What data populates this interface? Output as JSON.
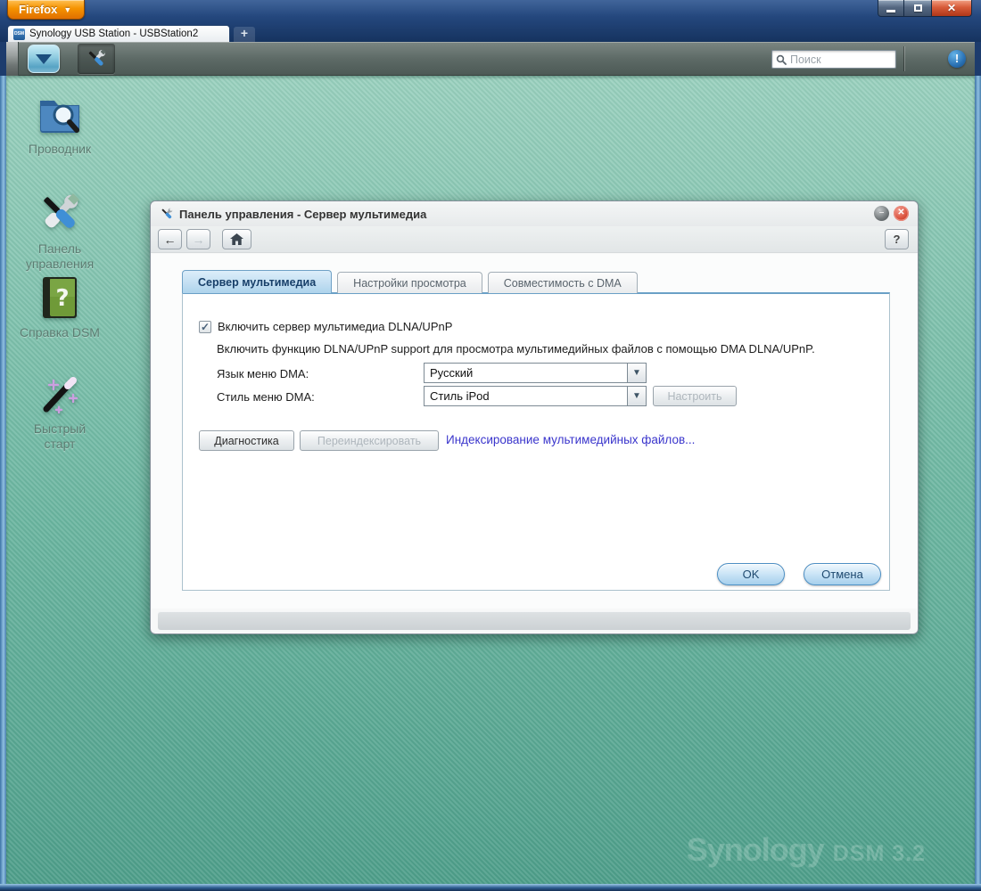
{
  "window": {
    "firefox_button": "Firefox",
    "tab_title": "Synology USB Station - USBStation2",
    "favicon_text": "DSM",
    "close_glyph": "✕",
    "newtab_glyph": "+"
  },
  "taskbar": {
    "search_placeholder": "Поиск",
    "notification_glyph": "!"
  },
  "desktop": {
    "icons": [
      {
        "label": "Проводник"
      },
      {
        "label": "Панель управления"
      },
      {
        "label": "Справка DSM"
      },
      {
        "label": "Быстрый старт"
      }
    ],
    "watermark_brand": "Synology",
    "watermark_version": "DSM 3.2"
  },
  "dialog": {
    "title": "Панель управления - Сервер мультимедиа",
    "minimize_glyph": "–",
    "close_glyph": "✕",
    "back_glyph": "←",
    "forward_glyph": "→",
    "help_glyph": "?",
    "tabs": [
      {
        "label": "Сервер мультимедиа",
        "active": true
      },
      {
        "label": "Настройки просмотра",
        "active": false
      },
      {
        "label": "Совместимость с DMA",
        "active": false
      }
    ],
    "enable_checkbox": {
      "checked": true,
      "check_glyph": "✓",
      "label": "Включить сервер мультимедиа DLNA/UPnP"
    },
    "description": "Включить функцию DLNA/UPnP support для просмотра мультимедийных файлов с помощью DMA DLNA/UPnP.",
    "language": {
      "label": "Язык меню DMA:",
      "value": "Русский",
      "chevron_glyph": "▼"
    },
    "style": {
      "label": "Стиль меню DMA:",
      "value": "Стиль iPod",
      "chevron_glyph": "▼"
    },
    "configure_button": {
      "label": "Настроить",
      "enabled": false
    },
    "diagnose_button": {
      "label": "Диагностика",
      "enabled": true
    },
    "reindex_button": {
      "label": "Переиндексировать",
      "enabled": false
    },
    "indexing_status": "Индексирование мультимедийных файлов...",
    "ok_button": "OK",
    "cancel_button": "Отмена"
  },
  "colors": {
    "desktop_teal": "#6cb6a1",
    "titlebar_navy": "#1d3c6d",
    "firefox_orange": "#f59300",
    "active_tab_blue": "#aed3ec",
    "panel_border_blue": "#6aa0c6",
    "link_blue": "#3a35cc",
    "pill_button_blue": "#a6cfec",
    "close_red": "#d94f3a"
  }
}
